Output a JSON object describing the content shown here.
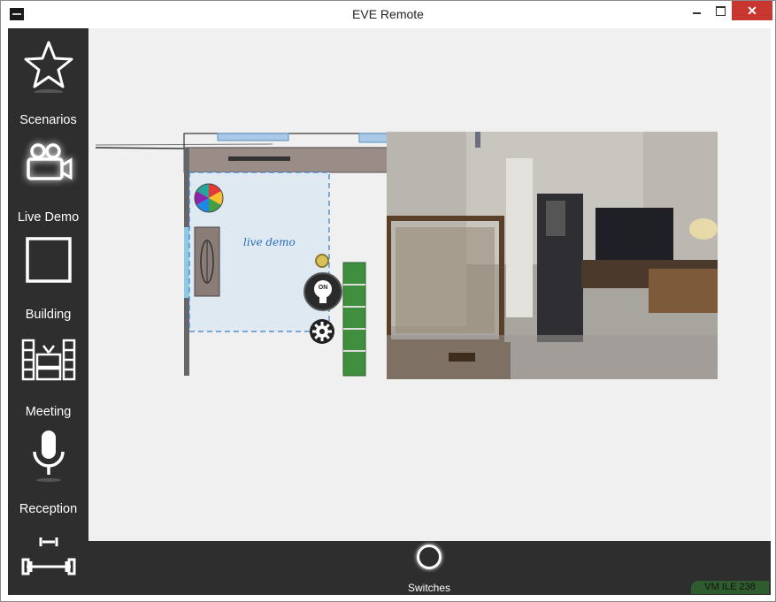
{
  "window": {
    "title": "EVE Remote",
    "close_glyph": "✕"
  },
  "sidebar": {
    "items": [
      {
        "label": "Scenarios",
        "icon": "star-icon"
      },
      {
        "label": "Live Demo",
        "icon": "camera-icon"
      },
      {
        "label": "Building",
        "icon": "square-icon"
      },
      {
        "label": "Meeting",
        "icon": "tv-icon"
      },
      {
        "label": "Reception",
        "icon": "microphone-icon"
      },
      {
        "label": "",
        "icon": "dumbbell-icon"
      }
    ]
  },
  "floorplan": {
    "room_label": "live demo",
    "light_button_text": "ON"
  },
  "bottombar": {
    "switches_label": "Switches",
    "status_text": "VM ILE 238"
  },
  "colors": {
    "sidebar_bg": "#2e2e2e",
    "main_bg": "#f0f0f0",
    "close_red": "#c7372f",
    "plan_blue": "#2a6cb8",
    "badge_green": "#2e5c2e"
  }
}
